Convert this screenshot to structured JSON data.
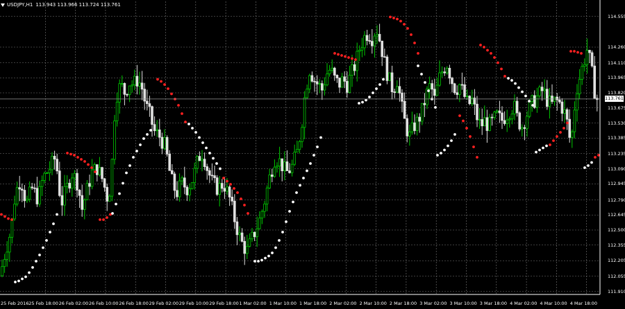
{
  "window": {
    "title_symbol": "USDJPY,H1",
    "title_prices": "113.943 113.966 113.724 113.761",
    "icon": "dropdown-triangle-icon"
  },
  "colors": {
    "background": "#000000",
    "grid": "#7a7a7a",
    "bull_candle": "#00c800",
    "bear_candle": "#e0e0e0",
    "sar_below": "#ffffff",
    "sar_above": "#ff2020",
    "price_line": "#9a9a9a"
  },
  "chart_data": {
    "type": "candlestick",
    "symbol": "USDJPY",
    "timeframe": "H1",
    "current_price": "113.761",
    "ylim": [
      111.88,
      114.7
    ],
    "y_ticks": [
      "114.555",
      "114.260",
      "114.110",
      "113.965",
      "113.820",
      "113.675",
      "113.530",
      "113.385",
      "113.235",
      "113.090",
      "112.945",
      "112.790",
      "112.645",
      "112.500",
      "112.355",
      "112.205",
      "112.055",
      "111.910"
    ],
    "x_ticks": [
      "25 Feb 2016",
      "25 Feb 18:00",
      "26 Feb 02:00",
      "26 Feb 10:00",
      "26 Feb 18:00",
      "29 Feb 02:00",
      "29 Feb 10:00",
      "29 Feb 18:00",
      "1 Mar 02:00",
      "1 Mar 10:00",
      "1 Mar 18:00",
      "2 Mar 02:00",
      "2 Mar 10:00",
      "2 Mar 18:00",
      "3 Mar 02:00",
      "3 Mar 10:00",
      "3 Mar 18:00",
      "4 Mar 02:00",
      "4 Mar 10:00",
      "4 Mar 18:00"
    ],
    "price_path": [
      [
        0,
        112.06
      ],
      [
        8,
        112.3
      ],
      [
        16,
        112.5
      ],
      [
        22,
        112.85
      ],
      [
        30,
        113.0
      ],
      [
        38,
        112.75
      ],
      [
        46,
        112.9
      ],
      [
        55,
        112.8
      ],
      [
        62,
        113.0
      ],
      [
        72,
        113.1
      ],
      [
        80,
        113.2
      ],
      [
        88,
        112.75
      ],
      [
        96,
        112.9
      ],
      [
        104,
        113.05
      ],
      [
        112,
        112.95
      ],
      [
        118,
        112.7
      ],
      [
        124,
        112.85
      ],
      [
        132,
        113.05
      ],
      [
        140,
        113.1
      ],
      [
        148,
        112.98
      ],
      [
        155,
        112.8
      ],
      [
        160,
        112.95
      ],
      [
        164,
        113.55
      ],
      [
        168,
        113.8
      ],
      [
        174,
        113.9
      ],
      [
        180,
        113.82
      ],
      [
        186,
        113.92
      ],
      [
        192,
        113.9
      ],
      [
        198,
        113.95
      ],
      [
        204,
        113.88
      ],
      [
        210,
        113.7
      ],
      [
        216,
        113.6
      ],
      [
        222,
        113.45
      ],
      [
        230,
        113.4
      ],
      [
        238,
        113.3
      ],
      [
        246,
        113.0
      ],
      [
        254,
        112.85
      ],
      [
        262,
        112.95
      ],
      [
        270,
        112.9
      ],
      [
        278,
        113.0
      ],
      [
        286,
        113.2
      ],
      [
        292,
        113.25
      ],
      [
        298,
        113.1
      ],
      [
        306,
        112.95
      ],
      [
        314,
        112.9
      ],
      [
        322,
        112.95
      ],
      [
        330,
        112.82
      ],
      [
        338,
        112.6
      ],
      [
        344,
        112.45
      ],
      [
        350,
        112.35
      ],
      [
        356,
        112.3
      ],
      [
        362,
        112.4
      ],
      [
        368,
        112.5
      ],
      [
        374,
        112.6
      ],
      [
        380,
        112.75
      ],
      [
        388,
        113.0
      ],
      [
        396,
        113.2
      ],
      [
        404,
        113.15
      ],
      [
        412,
        113.05
      ],
      [
        420,
        113.1
      ],
      [
        428,
        113.25
      ],
      [
        434,
        113.5
      ],
      [
        440,
        113.85
      ],
      [
        446,
        114.05
      ],
      [
        452,
        113.95
      ],
      [
        458,
        113.9
      ],
      [
        464,
        113.85
      ],
      [
        470,
        114.0
      ],
      [
        476,
        114.05
      ],
      [
        482,
        113.95
      ],
      [
        488,
        113.9
      ],
      [
        494,
        113.95
      ],
      [
        500,
        113.9
      ],
      [
        506,
        114.0
      ],
      [
        512,
        114.1
      ],
      [
        518,
        114.25
      ],
      [
        524,
        114.35
      ],
      [
        530,
        114.4
      ],
      [
        536,
        114.35
      ],
      [
        542,
        114.45
      ],
      [
        548,
        114.3
      ],
      [
        554,
        114.1
      ],
      [
        560,
        113.95
      ],
      [
        566,
        113.85
      ],
      [
        572,
        113.95
      ],
      [
        578,
        113.7
      ],
      [
        584,
        113.5
      ],
      [
        590,
        113.4
      ],
      [
        596,
        113.5
      ],
      [
        602,
        113.55
      ],
      [
        608,
        113.65
      ],
      [
        614,
        113.8
      ],
      [
        620,
        113.9
      ],
      [
        626,
        113.75
      ],
      [
        632,
        113.95
      ],
      [
        638,
        114.05
      ],
      [
        644,
        114.1
      ],
      [
        650,
        113.95
      ],
      [
        656,
        113.85
      ],
      [
        662,
        113.9
      ],
      [
        668,
        113.8
      ],
      [
        674,
        113.7
      ],
      [
        680,
        113.75
      ],
      [
        686,
        113.6
      ],
      [
        692,
        113.5
      ],
      [
        698,
        113.55
      ],
      [
        704,
        113.5
      ],
      [
        710,
        113.55
      ],
      [
        716,
        113.6
      ],
      [
        722,
        113.55
      ],
      [
        728,
        113.6
      ],
      [
        734,
        113.65
      ],
      [
        740,
        113.7
      ],
      [
        746,
        113.55
      ],
      [
        752,
        113.5
      ],
      [
        758,
        113.6
      ],
      [
        764,
        113.7
      ],
      [
        770,
        113.75
      ],
      [
        776,
        113.8
      ],
      [
        782,
        113.85
      ],
      [
        788,
        113.75
      ],
      [
        794,
        113.7
      ],
      [
        800,
        113.75
      ],
      [
        806,
        113.72
      ],
      [
        812,
        113.65
      ],
      [
        818,
        113.5
      ],
      [
        822,
        113.3
      ],
      [
        826,
        113.6
      ],
      [
        830,
        113.85
      ],
      [
        834,
        113.95
      ],
      [
        838,
        114.05
      ],
      [
        842,
        114.15
      ],
      [
        846,
        114.25
      ],
      [
        850,
        114.1
      ],
      [
        854,
        113.95
      ],
      [
        858,
        113.76
      ]
    ],
    "sar_dots": {
      "above": [
        [
          0,
          112.65
        ],
        [
          5,
          112.63
        ],
        [
          10,
          112.61
        ],
        [
          15,
          112.6
        ],
        [
          95,
          113.24
        ],
        [
          100,
          113.23
        ],
        [
          105,
          113.22
        ],
        [
          110,
          113.2
        ],
        [
          115,
          113.18
        ],
        [
          120,
          113.16
        ],
        [
          125,
          113.13
        ],
        [
          130,
          113.1
        ],
        [
          135,
          113.06
        ],
        [
          142,
          112.6
        ],
        [
          147,
          112.6
        ],
        [
          152,
          112.62
        ],
        [
          157,
          112.65
        ],
        [
          225,
          113.95
        ],
        [
          230,
          113.93
        ],
        [
          235,
          113.9
        ],
        [
          240,
          113.86
        ],
        [
          245,
          113.81
        ],
        [
          250,
          113.76
        ],
        [
          255,
          113.7
        ],
        [
          260,
          113.62
        ],
        [
          265,
          113.54
        ],
        [
          320,
          113.0
        ],
        [
          325,
          112.97
        ],
        [
          330,
          112.94
        ],
        [
          335,
          112.9
        ],
        [
          340,
          112.86
        ],
        [
          345,
          112.8
        ],
        [
          350,
          112.74
        ],
        [
          355,
          112.66
        ],
        [
          480,
          114.2
        ],
        [
          485,
          114.19
        ],
        [
          490,
          114.18
        ],
        [
          495,
          114.17
        ],
        [
          500,
          114.16
        ],
        [
          505,
          114.15
        ],
        [
          510,
          114.14
        ],
        [
          560,
          114.55
        ],
        [
          565,
          114.54
        ],
        [
          570,
          114.53
        ],
        [
          575,
          114.51
        ],
        [
          580,
          114.48
        ],
        [
          585,
          114.44
        ],
        [
          590,
          114.38
        ],
        [
          595,
          114.3
        ],
        [
          600,
          114.2
        ],
        [
          660,
          113.6
        ],
        [
          665,
          113.55
        ],
        [
          670,
          113.48
        ],
        [
          675,
          113.4
        ],
        [
          680,
          113.3
        ],
        [
          685,
          113.2
        ],
        [
          690,
          114.28
        ],
        [
          695,
          114.26
        ],
        [
          700,
          114.23
        ],
        [
          705,
          114.2
        ],
        [
          710,
          114.16
        ],
        [
          715,
          114.11
        ],
        [
          720,
          114.05
        ],
        [
          725,
          113.98
        ],
        [
          790,
          113.32
        ],
        [
          795,
          113.36
        ],
        [
          800,
          113.4
        ],
        [
          805,
          113.44
        ],
        [
          810,
          113.48
        ],
        [
          815,
          113.53
        ],
        [
          820,
          114.22
        ],
        [
          825,
          114.22
        ],
        [
          830,
          114.21
        ],
        [
          835,
          114.2
        ],
        [
          855,
          113.2
        ],
        [
          860,
          113.22
        ]
      ],
      "below": [
        [
          20,
          112.0
        ],
        [
          25,
          112.01
        ],
        [
          30,
          112.03
        ],
        [
          35,
          112.05
        ],
        [
          40,
          112.09
        ],
        [
          45,
          112.14
        ],
        [
          50,
          112.2
        ],
        [
          55,
          112.26
        ],
        [
          60,
          112.33
        ],
        [
          65,
          112.4
        ],
        [
          70,
          112.48
        ],
        [
          75,
          112.56
        ],
        [
          80,
          112.65
        ],
        [
          160,
          112.66
        ],
        [
          165,
          112.75
        ],
        [
          170,
          112.85
        ],
        [
          175,
          112.95
        ],
        [
          180,
          113.05
        ],
        [
          185,
          113.12
        ],
        [
          190,
          113.2
        ],
        [
          195,
          113.26
        ],
        [
          200,
          113.32
        ],
        [
          205,
          113.38
        ],
        [
          210,
          113.42
        ],
        [
          215,
          113.46
        ],
        [
          270,
          113.52
        ],
        [
          275,
          113.48
        ],
        [
          280,
          113.44
        ],
        [
          285,
          113.39
        ],
        [
          290,
          113.34
        ],
        [
          295,
          113.29
        ],
        [
          300,
          113.24
        ],
        [
          305,
          113.19
        ],
        [
          310,
          113.14
        ],
        [
          315,
          113.09
        ],
        [
          365,
          112.2
        ],
        [
          370,
          112.2
        ],
        [
          375,
          112.21
        ],
        [
          380,
          112.23
        ],
        [
          385,
          112.25
        ],
        [
          390,
          112.28
        ],
        [
          395,
          112.33
        ],
        [
          400,
          112.4
        ],
        [
          405,
          112.48
        ],
        [
          410,
          112.58
        ],
        [
          415,
          112.68
        ],
        [
          420,
          112.77
        ],
        [
          425,
          112.86
        ],
        [
          430,
          112.93
        ],
        [
          435,
          113.0
        ],
        [
          440,
          113.07
        ],
        [
          445,
          113.14
        ],
        [
          450,
          113.22
        ],
        [
          455,
          113.3
        ],
        [
          460,
          113.39
        ],
        [
          515,
          113.72
        ],
        [
          520,
          113.73
        ],
        [
          525,
          113.75
        ],
        [
          530,
          113.78
        ],
        [
          535,
          113.82
        ],
        [
          540,
          113.86
        ],
        [
          545,
          113.9
        ],
        [
          550,
          113.95
        ],
        [
          600,
          114.08
        ],
        [
          605,
          114.0
        ],
        [
          610,
          113.92
        ],
        [
          615,
          113.84
        ],
        [
          620,
          113.76
        ],
        [
          625,
          113.68
        ],
        [
          628,
          113.22
        ],
        [
          633,
          113.24
        ],
        [
          638,
          113.27
        ],
        [
          643,
          113.31
        ],
        [
          648,
          113.36
        ],
        [
          653,
          113.42
        ],
        [
          730,
          113.96
        ],
        [
          735,
          113.94
        ],
        [
          740,
          113.91
        ],
        [
          745,
          113.87
        ],
        [
          750,
          113.83
        ],
        [
          755,
          113.79
        ],
        [
          760,
          113.74
        ],
        [
          765,
          113.7
        ],
        [
          770,
          113.25
        ],
        [
          775,
          113.27
        ],
        [
          780,
          113.29
        ],
        [
          785,
          113.31
        ],
        [
          840,
          113.1
        ],
        [
          845,
          113.12
        ],
        [
          850,
          113.15
        ]
      ]
    }
  }
}
